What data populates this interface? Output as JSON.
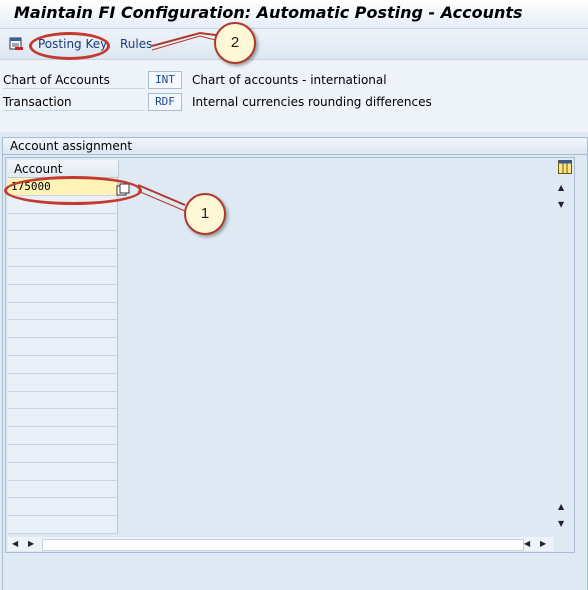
{
  "window": {
    "title": "Maintain FI Configuration: Automatic Posting - Accounts"
  },
  "toolbar": {
    "posting_key_label": "Posting Key",
    "rules_label": "Rules"
  },
  "header": {
    "chart_of_accounts": {
      "label": "Chart of Accounts",
      "value": "INT",
      "description": "Chart of accounts - international"
    },
    "transaction": {
      "label": "Transaction",
      "value": "RDF",
      "description": "Internal currencies rounding differences"
    }
  },
  "account_assignment": {
    "group_title": "Account assignment",
    "column_header": "Account",
    "rows": [
      "175000",
      "",
      "",
      "",
      "",
      "",
      "",
      "",
      "",
      "",
      "",
      "",
      "",
      "",
      "",
      "",
      "",
      "",
      "",
      ""
    ]
  },
  "annotations": {
    "callout_1": "1",
    "callout_2": "2"
  },
  "colors": {
    "accent_red": "#c33a2e",
    "active_cell": "#fff3b8",
    "link_blue": "#1a3a7a",
    "background": "#dfe9f4"
  }
}
